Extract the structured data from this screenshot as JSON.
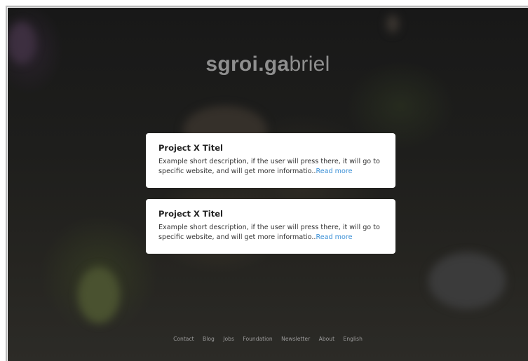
{
  "brand": {
    "bold": "sgroi.ga",
    "light": "briel"
  },
  "projects": [
    {
      "title": "Project X Titel",
      "description": "Example short description, if the user will press there, it will go to specific website, and will get more informatio..",
      "link_label": "Read more"
    },
    {
      "title": "Project X Titel",
      "description": "Example short description, if the user will press there, it will go to specific website, and will get more informatio..",
      "link_label": "Read more"
    }
  ],
  "footer": {
    "links": [
      "Contact",
      "Blog",
      "Jobs",
      "Foundation",
      "Newsletter",
      "About",
      "English"
    ]
  },
  "colors": {
    "accent": "#3a8fd6",
    "background": "#1e1e1c",
    "card": "#ffffff"
  }
}
